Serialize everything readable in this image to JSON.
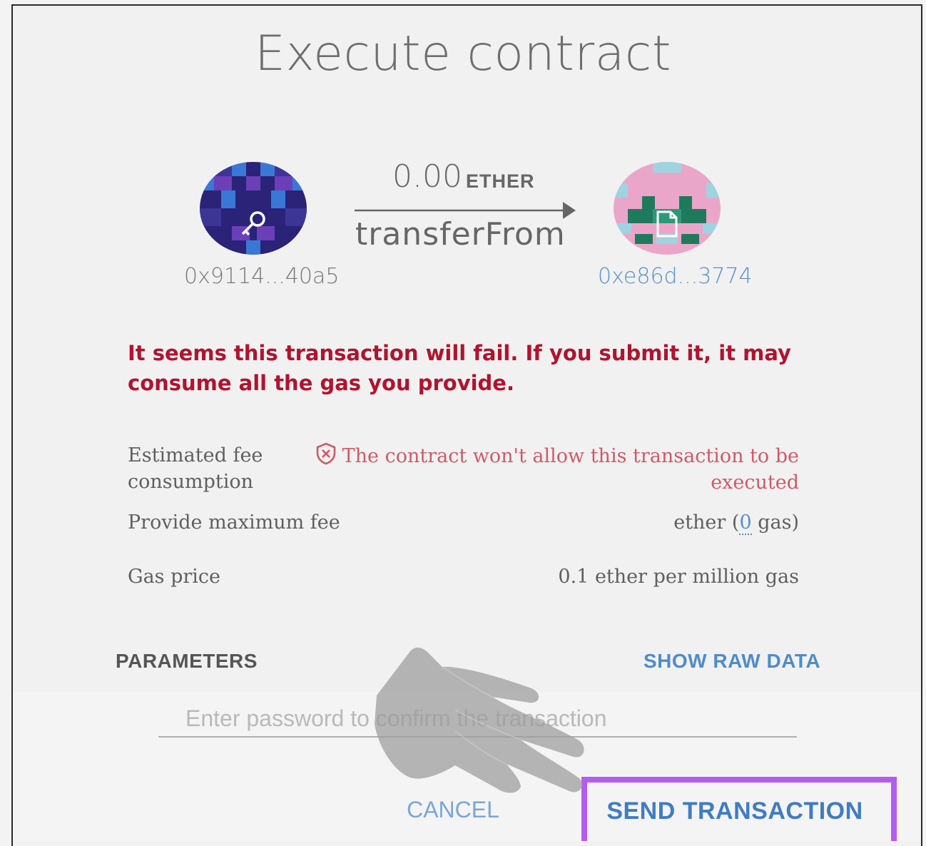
{
  "dialog": {
    "title": "Execute contract"
  },
  "transfer": {
    "from_address": "0x9114...40a5",
    "to_address": "0xe86d...3774",
    "amount": "0.00",
    "unit": "ETHER",
    "method": "transferFrom"
  },
  "warning": {
    "text": "It seems this transaction will fail. If you submit it, it may consume all the gas you provide."
  },
  "details": {
    "fee_label": "Estimated fee consumption",
    "fee_value": "The contract won't allow this transaction to be executed",
    "max_fee_label": "Provide maximum fee",
    "max_fee_prefix": "ether (",
    "max_fee_gas": "0",
    "max_fee_suffix": " gas)",
    "gas_price_label": "Gas price",
    "gas_price_value": "0.1 ether per million gas"
  },
  "parameters": {
    "label": "PARAMETERS",
    "raw_link": "SHOW RAW DATA"
  },
  "password": {
    "placeholder": "Enter password to confirm the transaction"
  },
  "actions": {
    "cancel": "CANCEL",
    "send": "SEND TRANSACTION"
  },
  "colors": {
    "warning": "#b3122e",
    "link": "#4f8cc9",
    "highlight": "#b45cf0"
  }
}
